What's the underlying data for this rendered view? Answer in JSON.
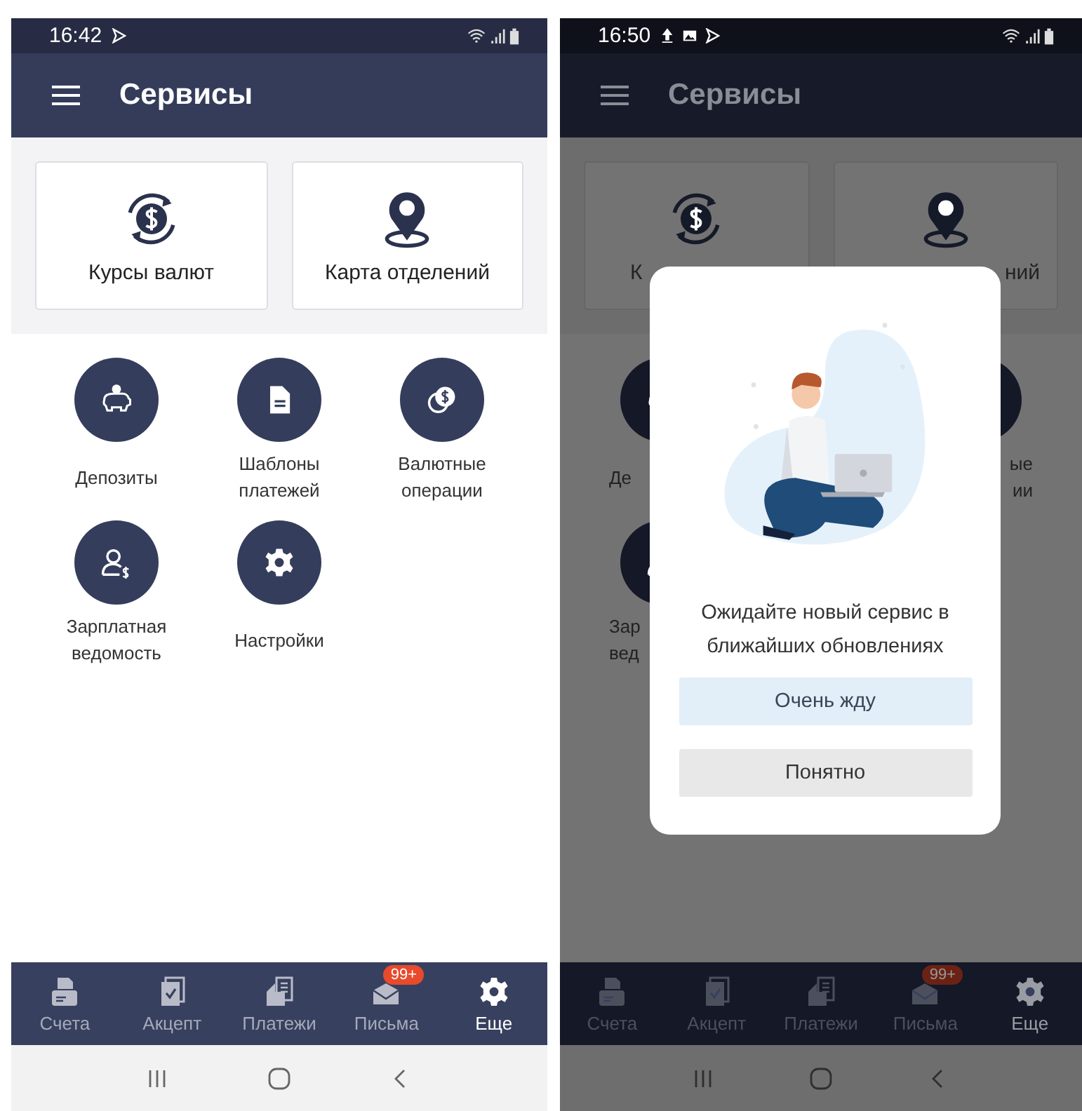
{
  "screens": [
    {
      "status_bar": {
        "time": "16:42"
      },
      "app_bar": {
        "title": "Сервисы"
      },
      "cards": [
        {
          "label": "Курсы валют"
        },
        {
          "label": "Карта отделений"
        }
      ],
      "services": [
        {
          "lines": [
            "Депозиты"
          ]
        },
        {
          "lines": [
            "Шаблоны",
            "платежей"
          ]
        },
        {
          "lines": [
            "Валютные",
            "операции"
          ]
        },
        {
          "lines": [
            "Зарплатная",
            "ведомость"
          ]
        },
        {
          "lines": [
            "Настройки"
          ]
        }
      ],
      "tabs": [
        {
          "label": "Счета",
          "selected": false
        },
        {
          "label": "Акцепт",
          "selected": false
        },
        {
          "label": "Платежи",
          "selected": false
        },
        {
          "label": "Письма",
          "selected": false,
          "badge": "99+"
        },
        {
          "label": "Еще",
          "selected": true
        }
      ]
    },
    {
      "status_bar": {
        "time": "16:50"
      },
      "app_bar": {
        "title": "Сервисы"
      },
      "cards": [
        {
          "label": "К"
        },
        {
          "label": "ний"
        }
      ],
      "services": [
        {
          "lines": [
            "Де"
          ]
        },
        {
          "lines": [
            "ые",
            "ии"
          ]
        },
        {
          "lines": [
            "Зар",
            "вед"
          ]
        }
      ],
      "tabs": [
        {
          "label": "Счета",
          "selected": false
        },
        {
          "label": "Акцепт",
          "selected": false
        },
        {
          "label": "Платежи",
          "selected": false
        },
        {
          "label": "Письма",
          "selected": false,
          "badge": "99+"
        },
        {
          "label": "Еще",
          "selected": true
        }
      ],
      "dialog": {
        "message": "Ожидайте новый сервис в ближайших обновлениях",
        "buttons": [
          {
            "label": "Очень жду",
            "kind": "primary"
          },
          {
            "label": "Понятно",
            "kind": "secondary"
          }
        ]
      }
    }
  ]
}
